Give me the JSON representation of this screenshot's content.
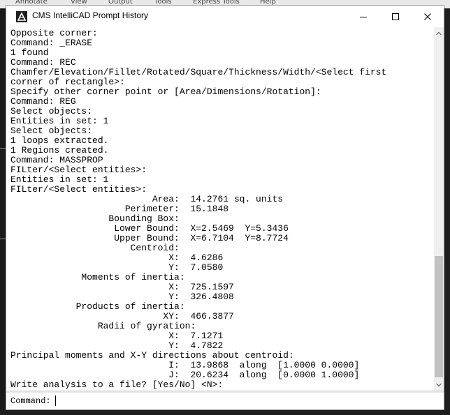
{
  "background_menu": [
    "Annotate",
    "View",
    "Output",
    "Tools",
    "Express Tools",
    "Help"
  ],
  "window": {
    "title": "CMS IntelliCAD Prompt History",
    "icon": "intellicad-app-icon"
  },
  "controls": {
    "minimize": "minimize-icon",
    "maximize": "maximize-icon",
    "close": "close-icon"
  },
  "history": [
    "Opposite corner:",
    "Command: _ERASE",
    "1 found",
    "Command: REC",
    "Chamfer/Elevation/Fillet/Rotated/Square/Thickness/Width/<Select first",
    "corner of rectangle>:",
    "Specify other corner point or [Area/Dimensions/Rotation]:",
    "Command: REG",
    "Select objects:",
    "Entities in set: 1",
    "Select objects:",
    "1 loops extracted.",
    "1 Regions created.",
    "Command: MASSPROP",
    "FILter/<Select entities>:",
    "Entities in set: 1",
    "FILter/<Select entities>:",
    "                          Area:  14.2761 sq. units",
    "                     Perimeter:  15.1848",
    "                  Bounding Box:",
    "                   Lower Bound:  X=2.5469  Y=5.3436",
    "                   Upper Bound:  X=6.7104  Y=8.7724",
    "                      Centroid:",
    "                             X:  4.6286",
    "                             Y:  7.0580",
    "             Moments of inertia:",
    "                             X:  725.1597",
    "                             Y:  326.4808",
    "            Products of inertia:",
    "                            XY:  466.3877",
    "                Radii of gyration:",
    "                             X:  7.1271",
    "                             Y:  4.7822",
    "Principal moments and X-Y directions about centroid:",
    "                             I:  13.9868  along  [1.0000 0.0000]",
    "                             J:  20.6234  along  [0.0000 1.0000]",
    "Write analysis to a file? [Yes/No] <N>:"
  ],
  "command_prompt": {
    "label": "Command:",
    "value": ""
  }
}
